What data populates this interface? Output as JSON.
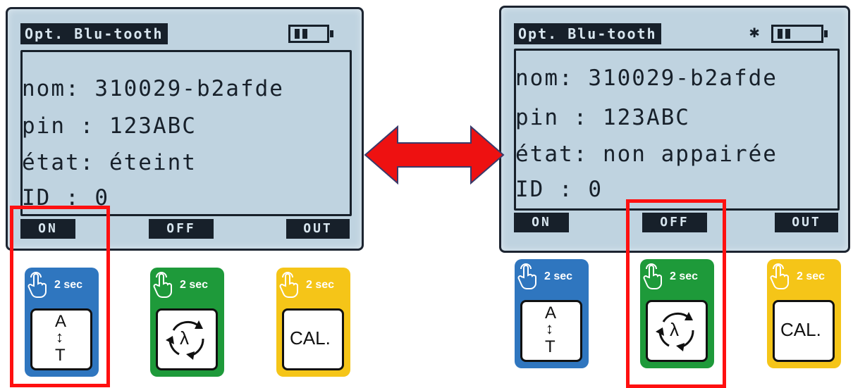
{
  "left_screen": {
    "title": "Opt. Blu-tooth",
    "lines": [
      "nom: 310029-b2afde",
      "pin : 123ABC",
      "état: éteint",
      "ID : 0"
    ],
    "softkeys": [
      "ON",
      "OFF",
      "OUT"
    ]
  },
  "right_screen": {
    "title": "Opt. Blu-tooth",
    "bluetooth_symbol": "✱",
    "lines": [
      "nom: 310029-b2afde",
      "pin : 123ABC",
      "état: non appairée",
      "ID : 0"
    ],
    "softkeys": [
      "ON",
      "OFF",
      "OUT"
    ]
  },
  "cards": {
    "hold_label": "2 sec",
    "blue": {
      "top": "A",
      "arrow": "↕",
      "bottom": "T"
    },
    "green": {
      "symbol": "λ"
    },
    "yellow": {
      "label": "CAL."
    }
  },
  "colors": {
    "lcd_bg": "#bfd3e0",
    "blue": "#2f76bf",
    "green": "#1e9a3a",
    "yellow": "#f5c518",
    "highlight": "#ff1010",
    "arrow": "#ee1111"
  },
  "icons": [
    "hand-pointer-icon",
    "bluetooth-icon",
    "battery-icon",
    "double-arrow-icon",
    "rotate-cycle-icon"
  ]
}
